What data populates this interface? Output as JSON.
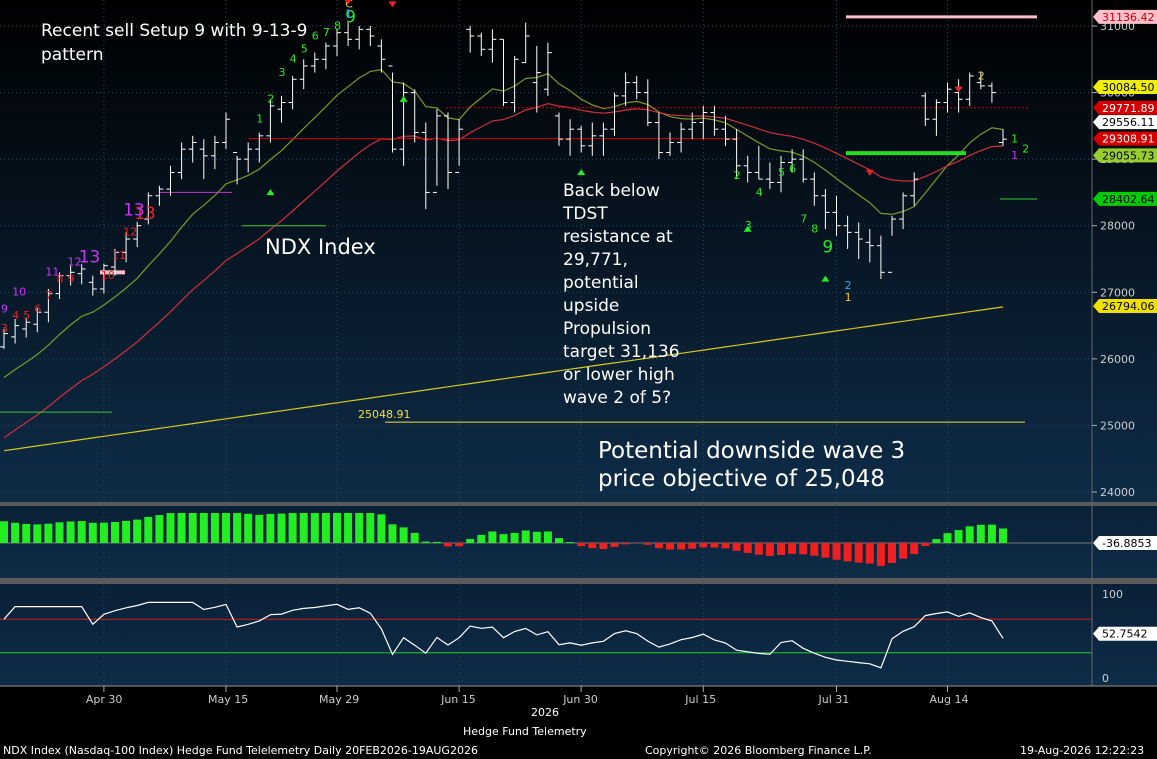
{
  "chart_data": {
    "type": "candlestick",
    "title": "Hedge Fund Telemetry",
    "instrument_label": "NDX Index",
    "footer": {
      "left": "NDX Index (Nasdaq-100 Index) Hedge Fund Telelemetry Daily 20FEB2026-19AUG2026",
      "center": "Copyright© 2026 Bloomberg Finance L.P.",
      "right": "19-Aug-2026 12:22:23",
      "year": "2026"
    },
    "annotations": {
      "setup_note": [
        "Recent sell Setup 9 with 9-13-9",
        "pattern"
      ],
      "tdst_note": [
        "Back below",
        "TDST",
        "resistance at",
        "29,771,",
        "potential",
        "upside",
        "Propulsion",
        "target 31,136",
        "or lower high",
        "wave 2 of 5?"
      ],
      "downside_note": [
        "Potential downside wave 3",
        "price objective of 25,048"
      ],
      "level_label": "25048.91"
    },
    "price_axis": {
      "ylim": [
        23800,
        31400
      ],
      "ticks": [
        "31000",
        "30000",
        "29000",
        "28000",
        "27000",
        "26000",
        "25000",
        "24000"
      ]
    },
    "price_tags": [
      {
        "value": "31136.42",
        "bg": "#ffc0cb",
        "fg": "#cc0000",
        "y_val": 31136.42
      },
      {
        "value": "30084.50",
        "bg": "#f0f000",
        "fg": "#000000",
        "y_val": 30084.5
      },
      {
        "value": "29771.89",
        "bg": "#d40000",
        "fg": "#ffffff",
        "y_val": 29771.89
      },
      {
        "value": "29556.11",
        "bg": "#ffffff",
        "fg": "#000000",
        "y_val": 29556.11
      },
      {
        "value": "29308.91",
        "bg": "#d40000",
        "fg": "#ffffff",
        "y_val": 29308.91
      },
      {
        "value": "29055.73",
        "bg": "#9acd32",
        "fg": "#000000",
        "y_val": 29055.73
      },
      {
        "value": "28402.64",
        "bg": "#00cc00",
        "fg": "#000000",
        "y_val": 28402.64
      },
      {
        "value": "26794.06",
        "bg": "#f0e000",
        "fg": "#000000",
        "y_val": 26794.06
      }
    ],
    "x_axis": {
      "labels": [
        {
          "label": "Apr 30",
          "i": 9
        },
        {
          "label": "May 15",
          "i": 20
        },
        {
          "label": "May 29",
          "i": 30
        },
        {
          "label": "Jun 15",
          "i": 41
        },
        {
          "label": "Jun 30",
          "i": 52
        },
        {
          "label": "Jul 15",
          "i": 63
        },
        {
          "label": "Jul 31",
          "i": 75
        },
        {
          "label": "Aug 14",
          "i": 85
        }
      ]
    },
    "candles": [
      [
        26180,
        26450,
        26150,
        26380
      ],
      [
        26330,
        26600,
        26230,
        26500
      ],
      [
        26450,
        26620,
        26320,
        26550
      ],
      [
        26520,
        26770,
        26400,
        26700
      ],
      [
        26700,
        27050,
        26550,
        26980
      ],
      [
        26980,
        27300,
        26900,
        27250
      ],
      [
        27250,
        27400,
        27100,
        27300
      ],
      [
        27280,
        27420,
        27120,
        27350
      ],
      [
        27150,
        27250,
        26950,
        27050
      ],
      [
        27050,
        27430,
        26980,
        27400
      ],
      [
        27380,
        27650,
        27250,
        27600
      ],
      [
        27600,
        27900,
        27450,
        27800
      ],
      [
        27800,
        28060,
        27680,
        28000
      ],
      [
        28100,
        28500,
        28020,
        28450
      ],
      [
        28450,
        28600,
        28300,
        28550
      ],
      [
        28550,
        28900,
        28450,
        28800
      ],
      [
        28800,
        29250,
        28700,
        29150
      ],
      [
        29150,
        29350,
        28950,
        29250
      ],
      [
        29150,
        29300,
        28700,
        29050
      ],
      [
        29050,
        29350,
        28850,
        29250
      ],
      [
        29250,
        29700,
        29150,
        29600
      ],
      [
        29100,
        29050,
        28620,
        29000
      ],
      [
        29000,
        29250,
        28800,
        29150
      ],
      [
        29150,
        29400,
        28950,
        29350
      ],
      [
        29350,
        29900,
        29250,
        29800
      ],
      [
        29750,
        29950,
        29550,
        29850
      ],
      [
        29850,
        30250,
        29750,
        30200
      ],
      [
        30200,
        30500,
        30050,
        30400
      ],
      [
        30400,
        30600,
        30300,
        30500
      ],
      [
        30500,
        30750,
        30350,
        30700
      ],
      [
        30700,
        30950,
        30550,
        30900
      ],
      [
        30900,
        31050,
        30700,
        30800
      ],
      [
        30800,
        31000,
        30650,
        30950
      ],
      [
        30950,
        31000,
        30700,
        30850
      ],
      [
        30700,
        30800,
        30300,
        30500
      ],
      [
        30400,
        30300,
        29100,
        29150
      ],
      [
        29150,
        30150,
        28900,
        30000
      ],
      [
        30000,
        30050,
        29250,
        29400
      ],
      [
        29400,
        29550,
        28250,
        28500
      ],
      [
        28500,
        29750,
        28600,
        29650
      ],
      [
        29650,
        29700,
        28550,
        28800
      ],
      [
        28800,
        29600,
        28900,
        29450
      ],
      [
        30950,
        31000,
        30600,
        30850
      ],
      [
        30850,
        30900,
        30550,
        30650
      ],
      [
        30650,
        30950,
        30450,
        30800
      ],
      [
        30800,
        30800,
        29800,
        29850
      ],
      [
        29850,
        30550,
        29700,
        30500
      ],
      [
        30450,
        31050,
        30450,
        30850
      ],
      [
        30150,
        30700,
        29700,
        30300
      ],
      [
        30050,
        30750,
        29950,
        30600
      ],
      [
        29650,
        29700,
        29200,
        29300
      ],
      [
        29300,
        29600,
        29050,
        29450
      ],
      [
        29450,
        29500,
        29100,
        29200
      ],
      [
        29200,
        29550,
        29050,
        29350
      ],
      [
        29350,
        29550,
        29050,
        29450
      ],
      [
        29450,
        30000,
        29350,
        29950
      ],
      [
        29950,
        30300,
        29800,
        30150
      ],
      [
        30150,
        30250,
        29900,
        30000
      ],
      [
        30000,
        30200,
        29500,
        29550
      ],
      [
        29550,
        29700,
        29000,
        29100
      ],
      [
        29100,
        29400,
        29050,
        29250
      ],
      [
        29250,
        29550,
        29100,
        29450
      ],
      [
        29450,
        29700,
        29300,
        29550
      ],
      [
        29550,
        29800,
        29300,
        29700
      ],
      [
        29700,
        29800,
        29350,
        29450
      ],
      [
        29450,
        29650,
        29200,
        29300
      ],
      [
        29300,
        29450,
        28700,
        28900
      ],
      [
        28900,
        29050,
        28650,
        28800
      ],
      [
        28800,
        29200,
        28700,
        28700
      ],
      [
        28700,
        28950,
        28550,
        28650
      ],
      [
        28650,
        29050,
        28500,
        28950
      ],
      [
        28950,
        29150,
        28800,
        29000
      ],
      [
        29000,
        29150,
        28650,
        28700
      ],
      [
        28700,
        28800,
        28300,
        28450
      ],
      [
        28450,
        28550,
        27950,
        28200
      ],
      [
        28200,
        28450,
        27850,
        28000
      ],
      [
        28000,
        28150,
        27650,
        27900
      ],
      [
        27900,
        28050,
        27500,
        27800
      ],
      [
        27750,
        27950,
        27450,
        27700
      ],
      [
        27700,
        27850,
        27200,
        27300
      ],
      [
        27300,
        28150,
        27850,
        28100
      ],
      [
        28100,
        28500,
        27950,
        28450
      ],
      [
        28450,
        28800,
        28300,
        28700
      ],
      [
        29950,
        30000,
        29500,
        29600
      ],
      [
        29600,
        29900,
        29350,
        29850
      ],
      [
        29850,
        30150,
        29700,
        30050
      ],
      [
        30000,
        30200,
        29700,
        29900
      ],
      [
        29900,
        30300,
        29800,
        30250
      ],
      [
        30150,
        30300,
        30050,
        30100
      ],
      [
        30100,
        30150,
        29850,
        30000
      ],
      [
        29250,
        29450,
        29200,
        29300
      ]
    ]
  }
}
